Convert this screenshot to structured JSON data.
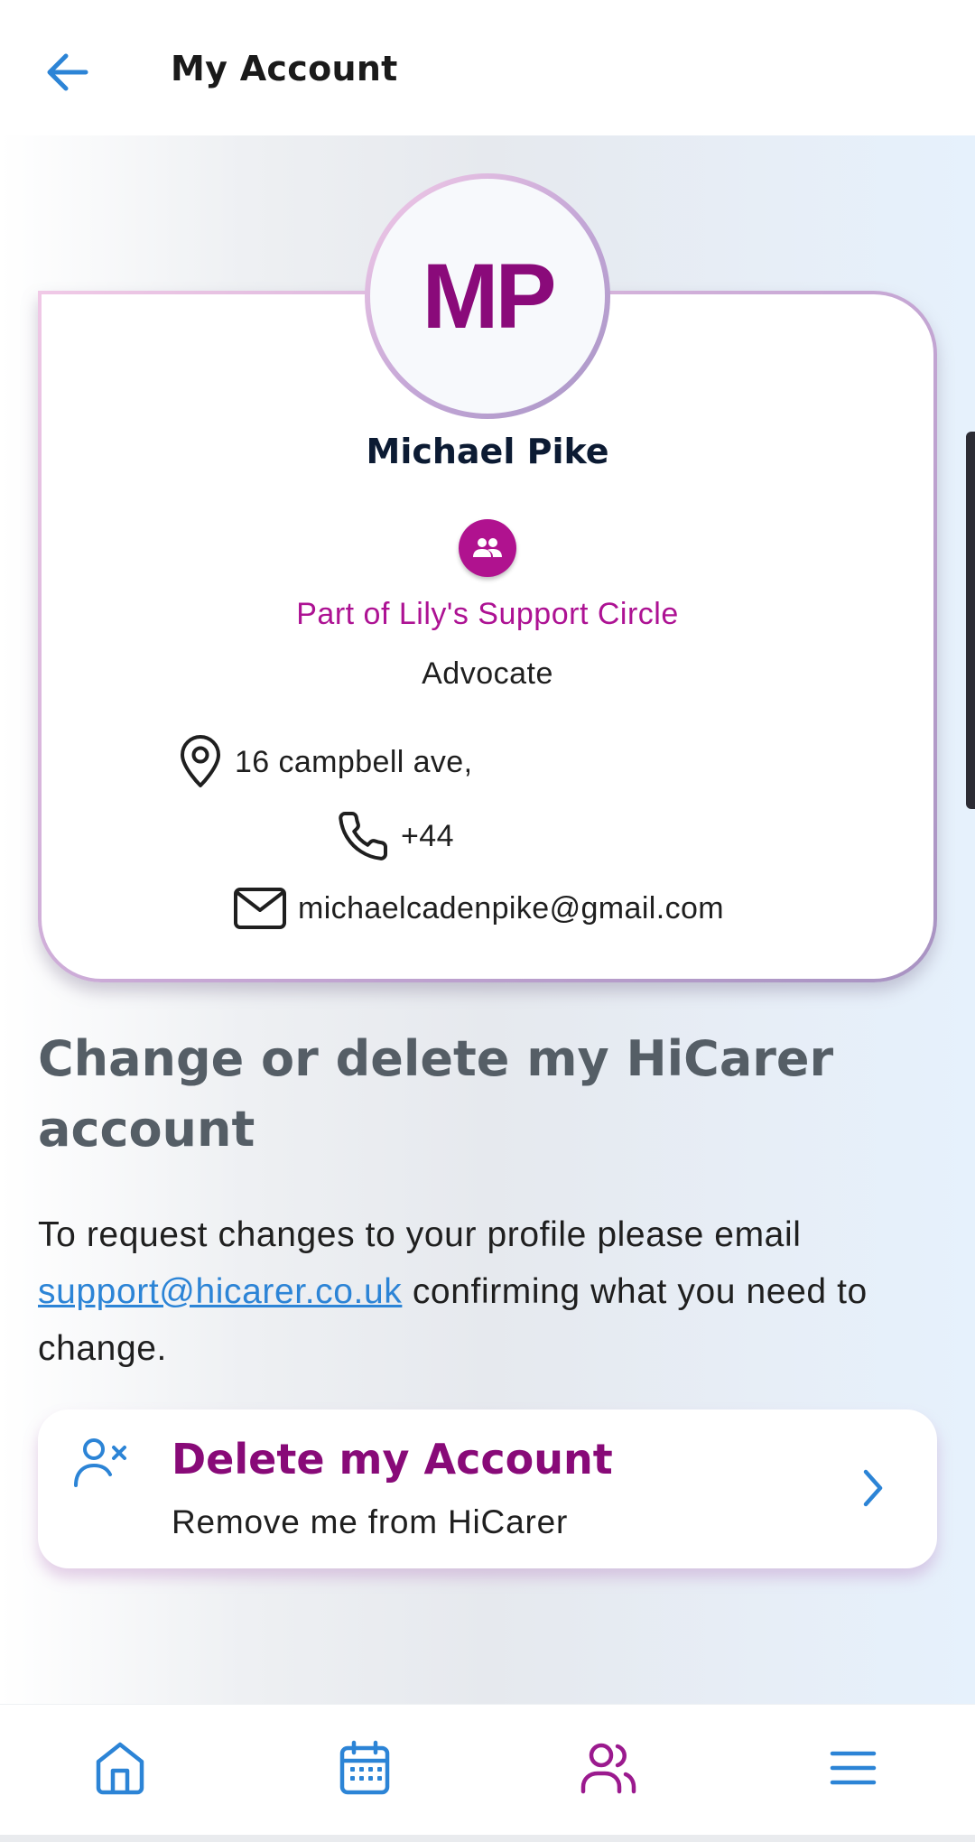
{
  "header": {
    "title": "My Account",
    "back_icon": "arrow-left-icon"
  },
  "profile": {
    "initials": "MP",
    "name": "Michael Pike",
    "circle_icon": "people-icon",
    "support_circle": "Part of Lily's Support Circle",
    "role": "Advocate",
    "address": "16 campbell ave,",
    "phone": "+44",
    "email": "michaelcadenpike@gmail.com"
  },
  "section": {
    "title": "Change or delete my HiCarer account",
    "body_before": "To request changes to your profile please email ",
    "support_email": "support@hicarer.co.uk",
    "body_after": " confirming what you need to change."
  },
  "delete_card": {
    "icon": "user-x-icon",
    "title": "Delete my Account",
    "subtitle": "Remove me from HiCarer"
  },
  "bottom_nav": [
    {
      "icon": "home-icon",
      "active": false
    },
    {
      "icon": "calendar-icon",
      "active": false
    },
    {
      "icon": "users-icon",
      "active": true
    },
    {
      "icon": "menu-icon",
      "active": false
    }
  ],
  "colors": {
    "accent_blue": "#2c84d6",
    "brand_purple": "#880a78",
    "magenta": "#b0128f"
  }
}
